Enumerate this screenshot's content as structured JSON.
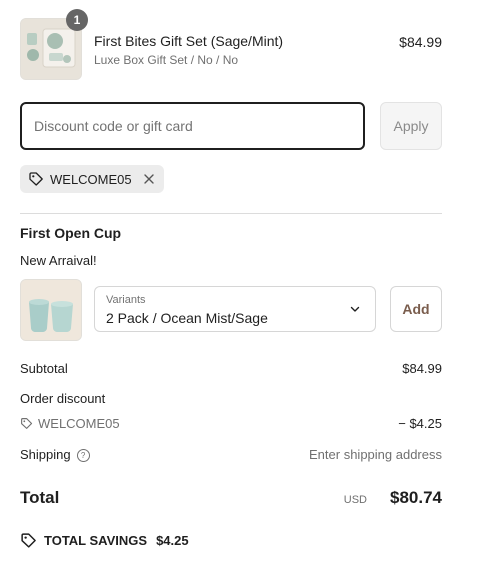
{
  "cart_item": {
    "quantity": "1",
    "name": "First Bites Gift Set (Sage/Mint)",
    "variant": "Luxe Box Gift Set / No / No",
    "price": "$84.99"
  },
  "discount": {
    "placeholder": "Discount code or gift card",
    "value": "",
    "apply_label": "Apply",
    "applied_code": "WELCOME05"
  },
  "upsell": {
    "title": "First Open Cup",
    "subtitle": "New Arraival!",
    "variants_label": "Variants",
    "variant_value": "2 Pack / Ocean Mist/Sage",
    "add_label": "Add"
  },
  "summary": {
    "subtotal_label": "Subtotal",
    "subtotal_value": "$84.99",
    "order_discount_label": "Order discount",
    "discount_code": "WELCOME05",
    "discount_value": "− $4.25",
    "shipping_label": "Shipping",
    "shipping_value": "Enter shipping address",
    "total_label": "Total",
    "currency": "USD",
    "total_value": "$80.74",
    "savings_label": "TOTAL SAVINGS",
    "savings_value": "$4.25"
  },
  "colors": {
    "text": "#1f1f1f",
    "muted": "#707070",
    "add_button_text": "#7a5d4d",
    "chip_bg": "#ececec"
  }
}
